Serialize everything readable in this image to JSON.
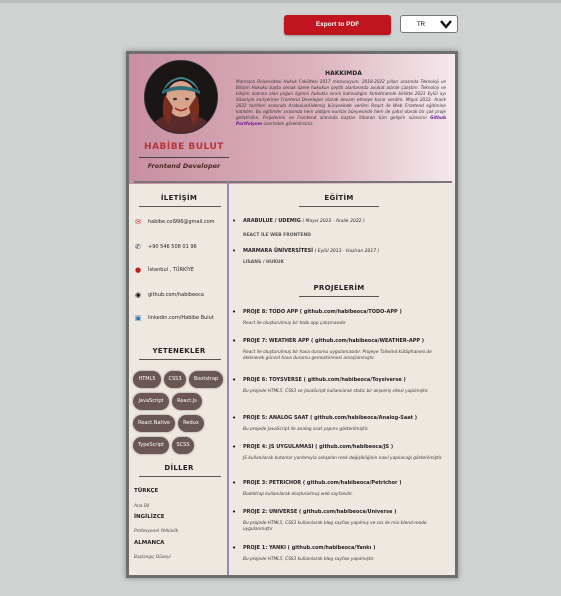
{
  "toolbar": {
    "export_label": "Export to PDF",
    "language_value": "TR"
  },
  "profile": {
    "name": "HABİBE BULUT",
    "role": "Frontend Developer"
  },
  "about": {
    "title": "HAKKIMDA",
    "text_before": "Marmara Üniversitesi Hukuk Fakültesi 2017 mezunuyum. 2018-2022 yılları arasında Teknoloji ve Bilişim Hukuku başta olmak üzere hukukun çeşitli alanlarında avukat olarak çalıştım. Teknoloji ve bilişim alanına olan yoğun ilgimin hukukla sınırlı kalmadığını farketmemle birlikte 2021 Eylül ayı itibariyle kariyerime Frontend Developer olarak devam etmeye karar verdim. Mayıs 2022- Aralık 2022 tarihleri arasında Arabulue/Udemig bünyesinde verilen React ile Web Frontend eğitimine katıldım. Bu eğitimler sırasında hem aldığım kurslar bünyesinde hem de şahsi olarak bir çok proje geliştirdim. Projelerimi ve Frontend alanında baştan itibaren tüm gelişim sürecimi",
    "link_text": "Github Portfolyom",
    "text_after": "üzerinden görebilirsiniz."
  },
  "contact": {
    "title": "İLETİŞİM",
    "items": [
      {
        "icon": "mail-icon",
        "glyph": "✉",
        "color": "#d9282f",
        "text": "habibe.col996@gmail.com"
      },
      {
        "icon": "phone-icon",
        "glyph": "✆",
        "color": "#2a3d66",
        "text": "+90 546 508 01 96"
      },
      {
        "icon": "location-icon",
        "glyph": "●",
        "color": "#c01c1c",
        "text": "İstanbul , TÜRKİYE"
      },
      {
        "icon": "github-icon",
        "glyph": "◉",
        "color": "#111111",
        "text": "github.com/habibeoca"
      },
      {
        "icon": "linkedin-icon",
        "glyph": "▣",
        "color": "#2b73b8",
        "text": "linkedin.com/Habibe Bulut"
      }
    ]
  },
  "skills": {
    "title": "YETENEKLER",
    "items": [
      "HTML5",
      "CSS3",
      "Bootstrap",
      "JavaScript",
      "React.Js",
      "React.Native",
      "Redux",
      "TypeScript",
      "SCSS"
    ]
  },
  "languages": {
    "title": "DİLLER",
    "items": [
      {
        "name": "TÜRKÇE",
        "level": "Ana Dil"
      },
      {
        "name": "İNGİLİZCE",
        "level": "Profesyonel Yetkinlik"
      },
      {
        "name": "ALMANCA",
        "level": "Başlangıç Düzeyi"
      }
    ]
  },
  "education": {
    "title": "EĞİTİM",
    "items": [
      {
        "school": "ARABULUE / UDEMIG",
        "dates": "( Mayıs 2022 - Aralık 2022 )",
        "detail": "REACT İLE WEB FRONTEND"
      },
      {
        "school": "MARMARA ÜNİVERSİTESİ",
        "dates": "( Eylül 2013 - Haziran 2017 )",
        "detail": "LİSANS / HUKUK"
      }
    ]
  },
  "projects": {
    "title": "PROJELERİM",
    "items": [
      {
        "title": "PROJE 8: TODO APP ( github.com/habibeoca/TODO-APP )",
        "desc": "React ile oluşturulmuş bir todo app çalışmasıdır."
      },
      {
        "title": "PROJE 7: WEATHER APP ( github.com/habibeoca/WEATHER-APP )",
        "desc": "React ile oluşturulmuş bir hava durumu uygulamasıdır. Projeye Tailwind kütüphanesi de eklenerek güncel hava durumu gemostirimesi amaçlanmıştır."
      },
      {
        "title": "PROJE 6: TOYSVERSE ( github.com/habibeoca/Toysiverse )",
        "desc": "Bu projede HTML5, CSS3 ve JavaScript kullanılarak static bir alışveriş sitesi yapılmıştır."
      },
      {
        "title": "PROJE 5: ANALOG SAAT ( github.com/habibeoca/Analog-Saat )",
        "desc": "Bu projede JavaScript ile analog saat yapımı gösterilmiştir."
      },
      {
        "title": "PROJE 4: JS UYGULAMASI ( github.com/habibeoca/JS )",
        "desc": "JS kullanılarak butonlar yardımıyla arkaplan renk değişikliğinin nasıl yapılacağı gösterilmiştir."
      },
      {
        "title": "PROJE 3: PETRICHOR ( github.com/habibeoca/Petrichor )",
        "desc": "Bootstrap kullanılarak oluşturulmuş web sayfasıdır."
      },
      {
        "title": "PROJE 2: UNIVERSE ( github.com/habibeoca/Universe )",
        "desc": "Bu projede HTML5, CSS3 kullanılarak blog sayfası yapılmış ve css ile mix-blend-mode uygulanmıştır"
      },
      {
        "title": "PROJE 1: YANKI ( github.com/habibeoca/Yankı )",
        "desc": "Bu projede HTML5, CSS3 kullanılarak blog sayfası yapılmıştır."
      }
    ]
  }
}
